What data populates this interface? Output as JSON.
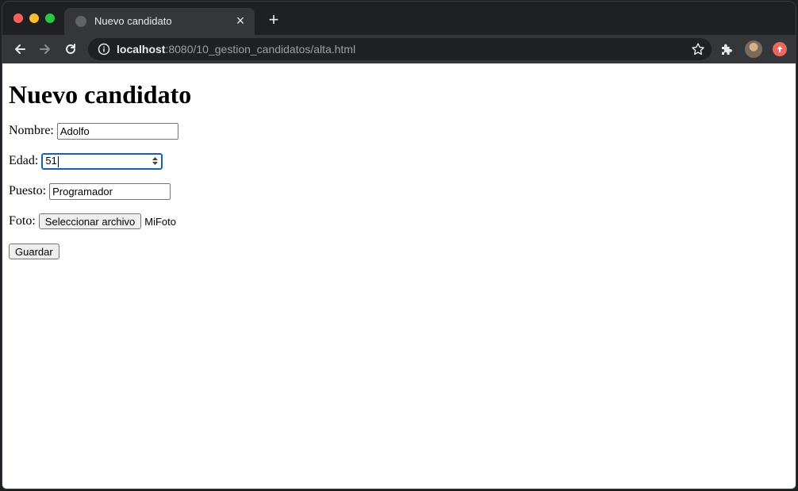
{
  "browser": {
    "tab_title": "Nuevo candidato",
    "url_host": "localhost",
    "url_rest": ":8080/10_gestion_candidatos/alta.html"
  },
  "page": {
    "title": "Nuevo candidato",
    "fields": {
      "nombre": {
        "label": "Nombre:",
        "value": "Adolfo"
      },
      "edad": {
        "label": "Edad:",
        "value": "51"
      },
      "puesto": {
        "label": "Puesto:",
        "value": "Programador"
      },
      "foto": {
        "label": "Foto:",
        "button_label": "Seleccionar archivo",
        "file_name": "MiFoto"
      }
    },
    "submit_label": "Guardar"
  },
  "icons": {
    "favicon": "globe-icon",
    "tab_close": "close-icon",
    "new_tab": "plus-icon",
    "back": "arrow-left-icon",
    "forward": "arrow-right-icon",
    "reload": "reload-icon",
    "site_info": "info-icon",
    "bookmark": "star-icon",
    "extensions": "puzzle-icon",
    "update": "update-icon"
  },
  "colors": {
    "focus_ring": "#1a5fb4",
    "update_badge": "#ee675c"
  }
}
